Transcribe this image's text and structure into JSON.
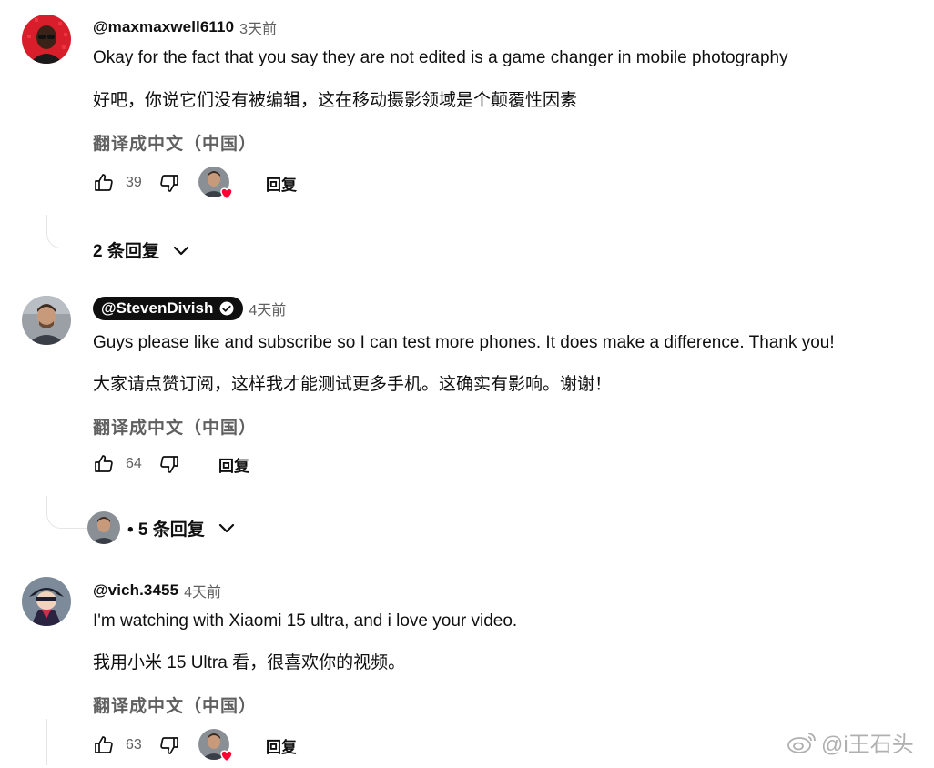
{
  "comments": [
    {
      "author": "@maxmaxwell6110",
      "time": "3天前",
      "text": "Okay for the fact that you say they are not edited is a game changer in mobile photography",
      "translation": "好吧，你说它们没有被编辑，这在移动摄影领域是个颠覆性因素",
      "translate_label": "翻译成中文（中国）",
      "likes": "39",
      "reply_label": "回复",
      "replies_label": "2 条回复",
      "creator_hearted": true
    },
    {
      "author": "@StevenDivish",
      "verified": true,
      "time": "4天前",
      "text": "Guys please like and subscribe so I can test more phones. It does make a difference. Thank you!",
      "translation": "大家请点赞订阅，这样我才能测试更多手机。这确实有影响。谢谢！",
      "translate_label": "翻译成中文（中国）",
      "likes": "64",
      "reply_label": "回复",
      "replies_label": "• 5 条回复",
      "creator_hearted": false
    },
    {
      "author": "@vich.3455",
      "time": "4天前",
      "text": "I'm watching with Xiaomi 15 ultra, and i love your video.",
      "translation": "我用小米 15 Ultra 看，很喜欢你的视频。",
      "translate_label": "翻译成中文（中国）",
      "likes": "63",
      "reply_label": "回复",
      "creator_hearted": true
    }
  ],
  "watermark": "@i王石头",
  "colors": {
    "heart": "#ff0033",
    "secondary_text": "#606060"
  }
}
